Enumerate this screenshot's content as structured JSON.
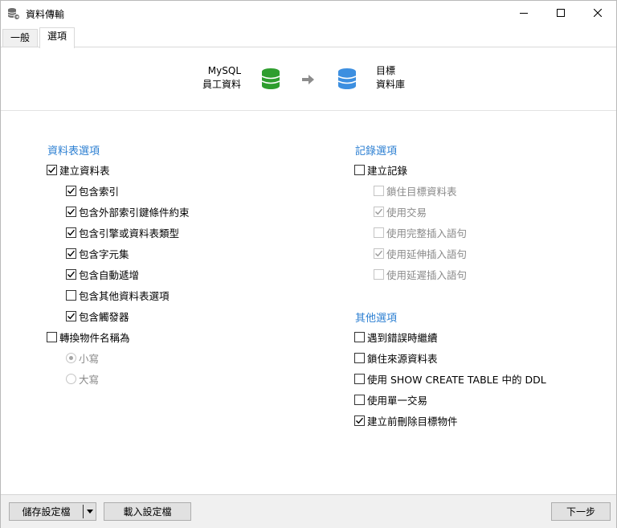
{
  "window": {
    "title": "資料傳輸",
    "controls": [
      "minimize",
      "maximize",
      "close"
    ]
  },
  "tabs": [
    {
      "label": "一般",
      "active": false
    },
    {
      "label": "選項",
      "active": true
    }
  ],
  "header": {
    "source": {
      "line1": "MySQL",
      "line2": "員工資料",
      "icon_color": "#2e9e2e"
    },
    "target": {
      "line1": "目標",
      "line2": "資料庫",
      "icon_color": "#3d8fe0"
    }
  },
  "table_options": {
    "title": "資料表選項",
    "items": [
      {
        "label": "建立資料表",
        "checked": true,
        "disabled": false
      },
      {
        "label": "包含索引",
        "checked": true,
        "disabled": false
      },
      {
        "label": "包含外部索引鍵條件約束",
        "checked": true,
        "disabled": false
      },
      {
        "label": "包含引擎或資料表類型",
        "checked": true,
        "disabled": false
      },
      {
        "label": "包含字元集",
        "checked": true,
        "disabled": false
      },
      {
        "label": "包含自動遞增",
        "checked": true,
        "disabled": false
      },
      {
        "label": "包含其他資料表選項",
        "checked": false,
        "disabled": false
      },
      {
        "label": "包含觸發器",
        "checked": true,
        "disabled": false
      },
      {
        "label": "轉換物件名稱為",
        "checked": false,
        "disabled": false
      }
    ],
    "case_options": [
      {
        "label": "小寫",
        "selected": true,
        "disabled": true
      },
      {
        "label": "大寫",
        "selected": false,
        "disabled": true
      }
    ]
  },
  "record_options": {
    "title": "記錄選項",
    "items": [
      {
        "label": "建立記錄",
        "checked": false,
        "disabled": false
      },
      {
        "label": "鎖住目標資料表",
        "checked": false,
        "disabled": true
      },
      {
        "label": "使用交易",
        "checked": true,
        "disabled": true
      },
      {
        "label": "使用完整插入語句",
        "checked": false,
        "disabled": true
      },
      {
        "label": "使用延伸插入語句",
        "checked": true,
        "disabled": true
      },
      {
        "label": "使用延遲插入語句",
        "checked": false,
        "disabled": true
      }
    ]
  },
  "other_options": {
    "title": "其他選項",
    "items": [
      {
        "label": "遇到錯誤時繼續",
        "checked": false,
        "disabled": false
      },
      {
        "label": "鎖住來源資料表",
        "checked": false,
        "disabled": false
      },
      {
        "label": "使用 SHOW CREATE TABLE 中的 DDL",
        "checked": false,
        "disabled": false
      },
      {
        "label": "使用單一交易",
        "checked": false,
        "disabled": false
      },
      {
        "label": "建立前刪除目標物件",
        "checked": true,
        "disabled": false
      }
    ]
  },
  "footer": {
    "save_profile": "儲存設定檔",
    "load_profile": "載入設定檔",
    "next": "下一步"
  },
  "colors": {
    "section_title": "#2c7fd2",
    "source_db": "#2e9e2e",
    "target_db": "#3d8fe0"
  }
}
